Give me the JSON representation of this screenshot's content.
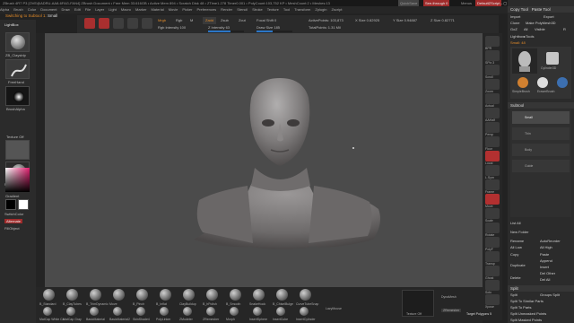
{
  "app": {
    "title": "ZBrush 4R7 P3 [OVE@ADRU-AA8-6FAG-FAN4] ZBrush Document • Free Mem 33.616GB • Active Mem 894 • Scratch Disk 48 • ZTime1.278 Timer0.001 • PolyCount:103,752 KP • MeshCount:2 • Meshes:13",
    "quicksave": "QuickSave",
    "seethrough": "See-through 0",
    "menus": "Menus",
    "defaultscript": "DefaultZScript"
  },
  "menubar": [
    "Alpha",
    "Brush",
    "Color",
    "Document",
    "Draw",
    "Edit",
    "File",
    "Layer",
    "Light",
    "Macro",
    "Marker",
    "Material",
    "Movie",
    "Picker",
    "Preferences",
    "Render",
    "Stencil",
    "Stroke",
    "Texture",
    "Tool",
    "Transform",
    "Zplugin",
    "Zscript"
  ],
  "switch": {
    "prefix": "Switching to Subtool 1: ",
    "name": "Small"
  },
  "topbar": {
    "zadd": "Zadd",
    "zsub": "Zsub",
    "zcut": "Zcut",
    "focal": "Focal Shift 0",
    "drawsize": "Draw Size 185",
    "zintensity": "Z Intensity 63",
    "activepoints": "ActivePoints: 103,873",
    "totalpoints": "TotalPoints: 1.31 Mil",
    "xsize": "X Size 0.82925",
    "ysize": "Y Size 0.94887",
    "zsize": "Z Size 0.82771",
    "mrgb": "Mrgb",
    "rgb": "Rgb",
    "m": "M",
    "rgbintensity": "Rgb Intensity 100"
  },
  "left": {
    "lightbox": "LightBox",
    "brush": "ZB_Claystrip",
    "stroke": "FreeHand",
    "alpha": "BrushAlpha",
    "texture": "Texture Off",
    "material": "MatCap Gray",
    "gradient": "Gradient",
    "switchcolor": "SwitchColor",
    "alternate": "Alternate",
    "fillobject": "FillObject"
  },
  "rightstrip": [
    "BPR",
    "SPix 3",
    "Scroll",
    "Zoom",
    "Actual",
    "AAHalf",
    "Persp",
    "Floor",
    "Local",
    "L.Sym",
    "Frame",
    "Move",
    "Scale",
    "Rotate",
    "PolyF",
    "Transp",
    "Ghost",
    "Solo",
    "Xpose"
  ],
  "rightpanel": {
    "copytool": "Copy Tool",
    "pastetool": "Paste Tool",
    "import": "Import",
    "export": "Export",
    "clone": "Clone",
    "makepolymesh": "Make PolyMesh3D",
    "goz": "GoZ",
    "all": "All",
    "visible": "Visible",
    "r": "R",
    "lightboxtools": "Lightbox▸Tools",
    "small": "Small: 48",
    "tools": [
      "Small",
      "Cylinder3D",
      "PolyMesh3D",
      "SimpleBrush",
      "EraserBrush",
      "PM3D_Sphere3D",
      "Thin_Stylus_Re"
    ],
    "subtool": "Subtool",
    "subtools": [
      "Small",
      "Thin",
      "Body",
      "Guide"
    ],
    "listall": "List All",
    "newfolder": "New Folder",
    "rename": "Rename",
    "autoreorder": "AutoReorder",
    "alllow": "All Low",
    "allhigh": "All High",
    "copy": "Copy",
    "paste": "Paste",
    "append": "Append",
    "duplicate": "Duplicate",
    "insert": "Insert",
    "deloth": "Del Other",
    "delete": "Delete",
    "delall": "Del All",
    "split": "Split",
    "grouplit": "Groups Split",
    "splitsimilar": "Split To Similar Parts",
    "splitparts": "Split To Parts",
    "splitunmasked": "Split Unmasked Points",
    "splitmasked": "Split Masked Points"
  },
  "bottom": {
    "brushes": [
      {
        "top": "B_Standard",
        "bot": "MatCap White Ca"
      },
      {
        "top": "B_ClayTubes",
        "bot": "MatCap Gray"
      },
      {
        "top": "B_TrimDynamic",
        "bot": "BasicMaterial"
      },
      {
        "top": "Move",
        "bot": "BasicMaterial2"
      },
      {
        "top": "B_Pinch",
        "bot": "SkinShade4"
      },
      {
        "top": "B_Inflat",
        "bot": "PolyLinker"
      },
      {
        "top": "ClayBuildup",
        "bot": "ZModeler"
      },
      {
        "top": "B_hPolish",
        "bot": "ZRemesher"
      },
      {
        "top": "B_Smooth",
        "bot": "Morph"
      },
      {
        "top": "SnakeHook",
        "bot": "InsertSphere"
      },
      {
        "top": "B_ChiselBulge",
        "bot": "InsertCube"
      },
      {
        "top": "CurveTubeSnap",
        "bot": "InsertCylinder"
      }
    ],
    "lazymouse": "LazyMouse",
    "texoff": "Texture Off",
    "dynamesh": "DynaMesh",
    "zremesher": "ZRemesher",
    "targetpoly": "Target Polygons 5"
  }
}
